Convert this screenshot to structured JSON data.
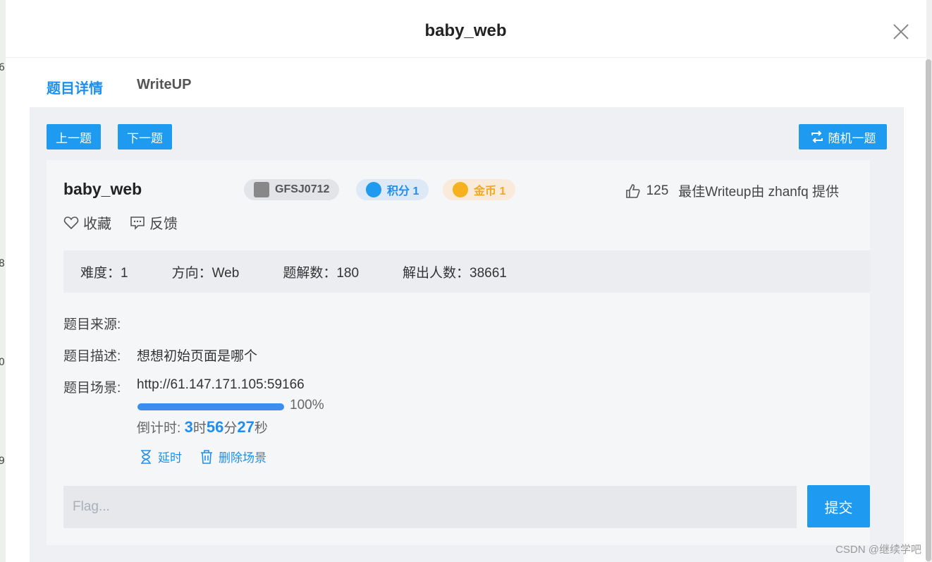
{
  "modal": {
    "title": "baby_web"
  },
  "tabs": [
    {
      "label": "题目详情",
      "active": true
    },
    {
      "label": "WriteUP",
      "active": false
    }
  ],
  "nav": {
    "prev": "上一题",
    "next": "下一题",
    "random": "随机一题"
  },
  "challenge": {
    "name": "baby_web",
    "badges": {
      "id": "GFSJ0712",
      "points": "积分 1",
      "coins": "金币 1"
    },
    "likes": "125",
    "best_writeup": "最佳Writeup由 zhanfq 提供",
    "actions": {
      "favorite": "收藏",
      "feedback": "反馈"
    },
    "info": {
      "difficulty": "难度：1",
      "direction": "方向：Web",
      "solves": "题解数：180",
      "solvers": "解出人数：38661"
    },
    "source_label": "题目来源:",
    "source_value": "",
    "desc_label": "题目描述:",
    "desc_value": "想想初始页面是哪个",
    "scene_label": "题目场景:",
    "scene_url": "http://61.147.171.105:59166",
    "progress": "100%",
    "countdown_label": "倒计时:",
    "countdown": {
      "h": "3",
      "h_unit": "时",
      "m": "56",
      "m_unit": "分",
      "s": "27",
      "s_unit": "秒"
    },
    "scene_ops": {
      "extend": "延时",
      "delete": "删除场景"
    },
    "flag_placeholder": "Flag...",
    "submit": "提交"
  },
  "backdrop": {
    "digits": [
      "6",
      "8",
      "0",
      "9"
    ]
  },
  "watermark": "CSDN @继续学吧",
  "colors": {
    "accent": "#1e9af0",
    "coin": "#f5a623"
  }
}
